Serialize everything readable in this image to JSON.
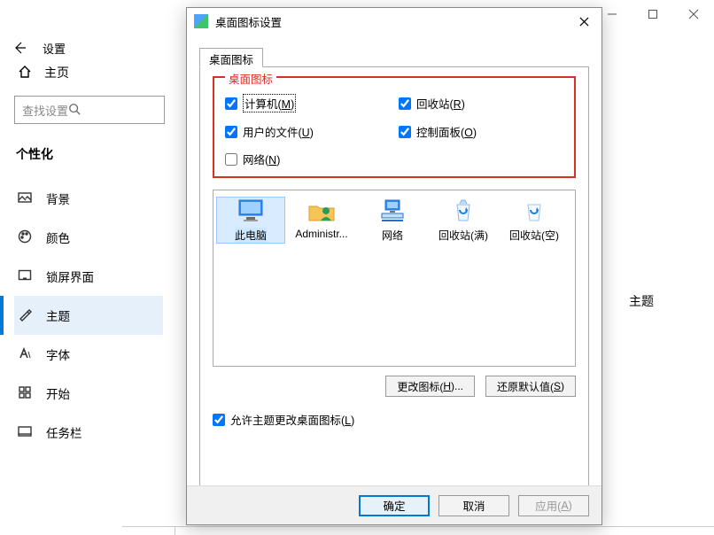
{
  "settings": {
    "title": "设置",
    "home": "主页",
    "search_placeholder": "查找设置",
    "category": "个性化",
    "nav": [
      {
        "label": "背景"
      },
      {
        "label": "颜色"
      },
      {
        "label": "锁屏界面"
      },
      {
        "label": "主题"
      },
      {
        "label": "字体"
      },
      {
        "label": "开始"
      },
      {
        "label": "任务栏"
      }
    ],
    "content_stub": "主题"
  },
  "dialog": {
    "title": "桌面图标设置",
    "tab": "桌面图标",
    "group_label": "桌面图标",
    "checkboxes": {
      "computer": {
        "pre": "计算机(",
        "key": "M",
        "post": ")",
        "checked": true
      },
      "recycle": {
        "pre": "回收站(",
        "key": "R",
        "post": ")",
        "checked": true
      },
      "userfiles": {
        "pre": "用户的文件(",
        "key": "U",
        "post": ")",
        "checked": true
      },
      "controlpanel": {
        "pre": "控制面板(",
        "key": "O",
        "post": ")",
        "checked": true
      },
      "network": {
        "pre": "网络(",
        "key": "N",
        "post": ")",
        "checked": false
      }
    },
    "preview": [
      {
        "label": "此电脑"
      },
      {
        "label": "Administr..."
      },
      {
        "label": "网络"
      },
      {
        "label": "回收站(满)"
      },
      {
        "label": "回收站(空)"
      }
    ],
    "buttons": {
      "change_icon": {
        "pre": "更改图标(",
        "key": "H",
        "post": ")..."
      },
      "restore": {
        "pre": "还原默认值(",
        "key": "S",
        "post": ")"
      }
    },
    "allow_themes": {
      "pre": "允许主题更改桌面图标(",
      "key": "L",
      "post": ")",
      "checked": true
    },
    "footer": {
      "ok": "确定",
      "cancel": "取消",
      "apply": {
        "pre": "应用(",
        "key": "A",
        "post": ")"
      }
    }
  }
}
